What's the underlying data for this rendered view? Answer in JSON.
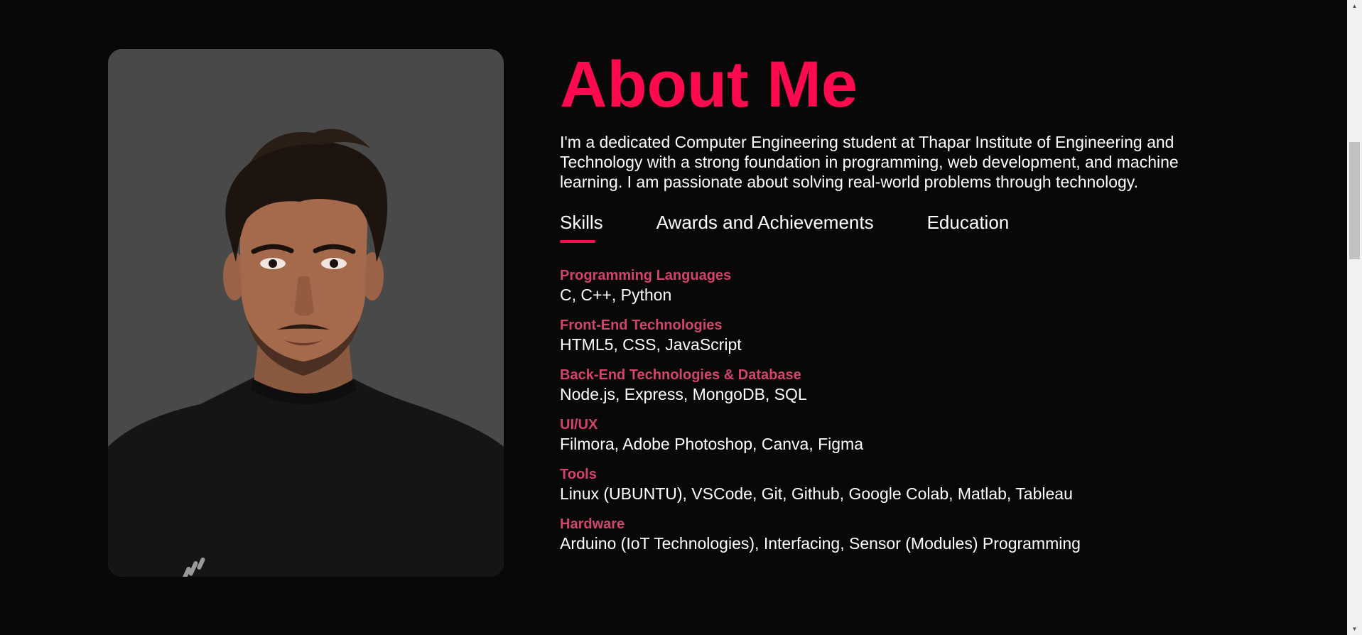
{
  "about": {
    "title": "About Me",
    "intro": "I'm a dedicated Computer Engineering student at Thapar Institute of Engineering and Technology with a strong foundation in programming, web development, and machine learning. I am passionate about solving real-world problems through technology."
  },
  "tabs": [
    {
      "label": "Skills",
      "active": true
    },
    {
      "label": "Awards and Achievements",
      "active": false
    },
    {
      "label": "Education",
      "active": false
    }
  ],
  "skills": [
    {
      "title": "Programming Languages",
      "items": "C, C++, Python"
    },
    {
      "title": "Front-End Technologies",
      "items": "HTML5, CSS, JavaScript"
    },
    {
      "title": "Back-End Technologies & Database",
      "items": "Node.js, Express, MongoDB, SQL"
    },
    {
      "title": "UI/UX",
      "items": "Filmora, Adobe Photoshop, Canva, Figma"
    },
    {
      "title": "Tools",
      "items": "Linux (UBUNTU), VSCode, Git, Github, Google Colab, Matlab, Tableau"
    },
    {
      "title": "Hardware",
      "items": "Arduino (IoT Technologies), Interfacing, Sensor (Modules) Programming"
    }
  ],
  "colors": {
    "background": "#080808",
    "accent": "#ff0a4f",
    "skill_title": "#d3446c",
    "photo_bg": "#4a4949"
  },
  "icons": {
    "scroll_up": "triangle-up-icon",
    "scroll_down": "triangle-down-icon"
  }
}
